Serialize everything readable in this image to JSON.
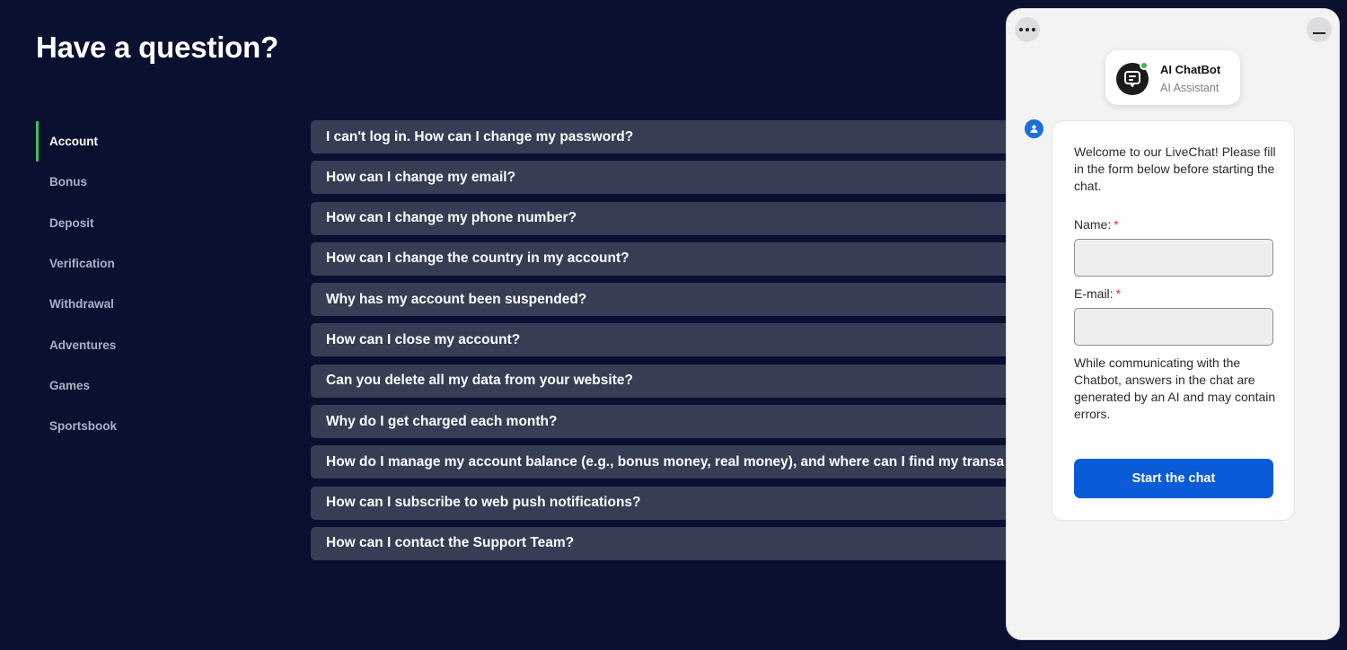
{
  "page": {
    "title": "Have a question?"
  },
  "sidebar": {
    "items": [
      {
        "label": "Account",
        "active": true
      },
      {
        "label": "Bonus"
      },
      {
        "label": "Deposit"
      },
      {
        "label": "Verification"
      },
      {
        "label": "Withdrawal"
      },
      {
        "label": "Adventures"
      },
      {
        "label": "Games"
      },
      {
        "label": "Sportsbook"
      }
    ]
  },
  "faq": {
    "items": [
      "I can't log in. How can I change my password?",
      "How can I change my email?",
      "How can I change my phone number?",
      "How can I change the country in my account?",
      "Why has my account been suspended?",
      "How can I close my account?",
      "Can you delete all my data from your website?",
      "Why do I get charged each month?",
      "How do I manage my account balance (e.g., bonus money, real money), and where can I find my transa",
      "How can I subscribe to web push notifications?",
      "How can I contact the Support Team?"
    ]
  },
  "chat": {
    "agent_name": "AI ChatBot",
    "agent_role": "AI Assistant",
    "welcome": "Welcome to our LiveChat! Please fill in the form below before starting the chat.",
    "name_label": "Name:",
    "email_label": "E-mail:",
    "required_mark": "*",
    "name_value": "",
    "email_value": "",
    "disclaimer": "While communicating with the Chatbot, answers in the chat are generated by an AI and may contain errors.",
    "start_label": "Start the chat",
    "colors": {
      "accent": "#0a5bd8",
      "online": "#3cb55a",
      "active_indicator": "#3fbf5a"
    }
  }
}
